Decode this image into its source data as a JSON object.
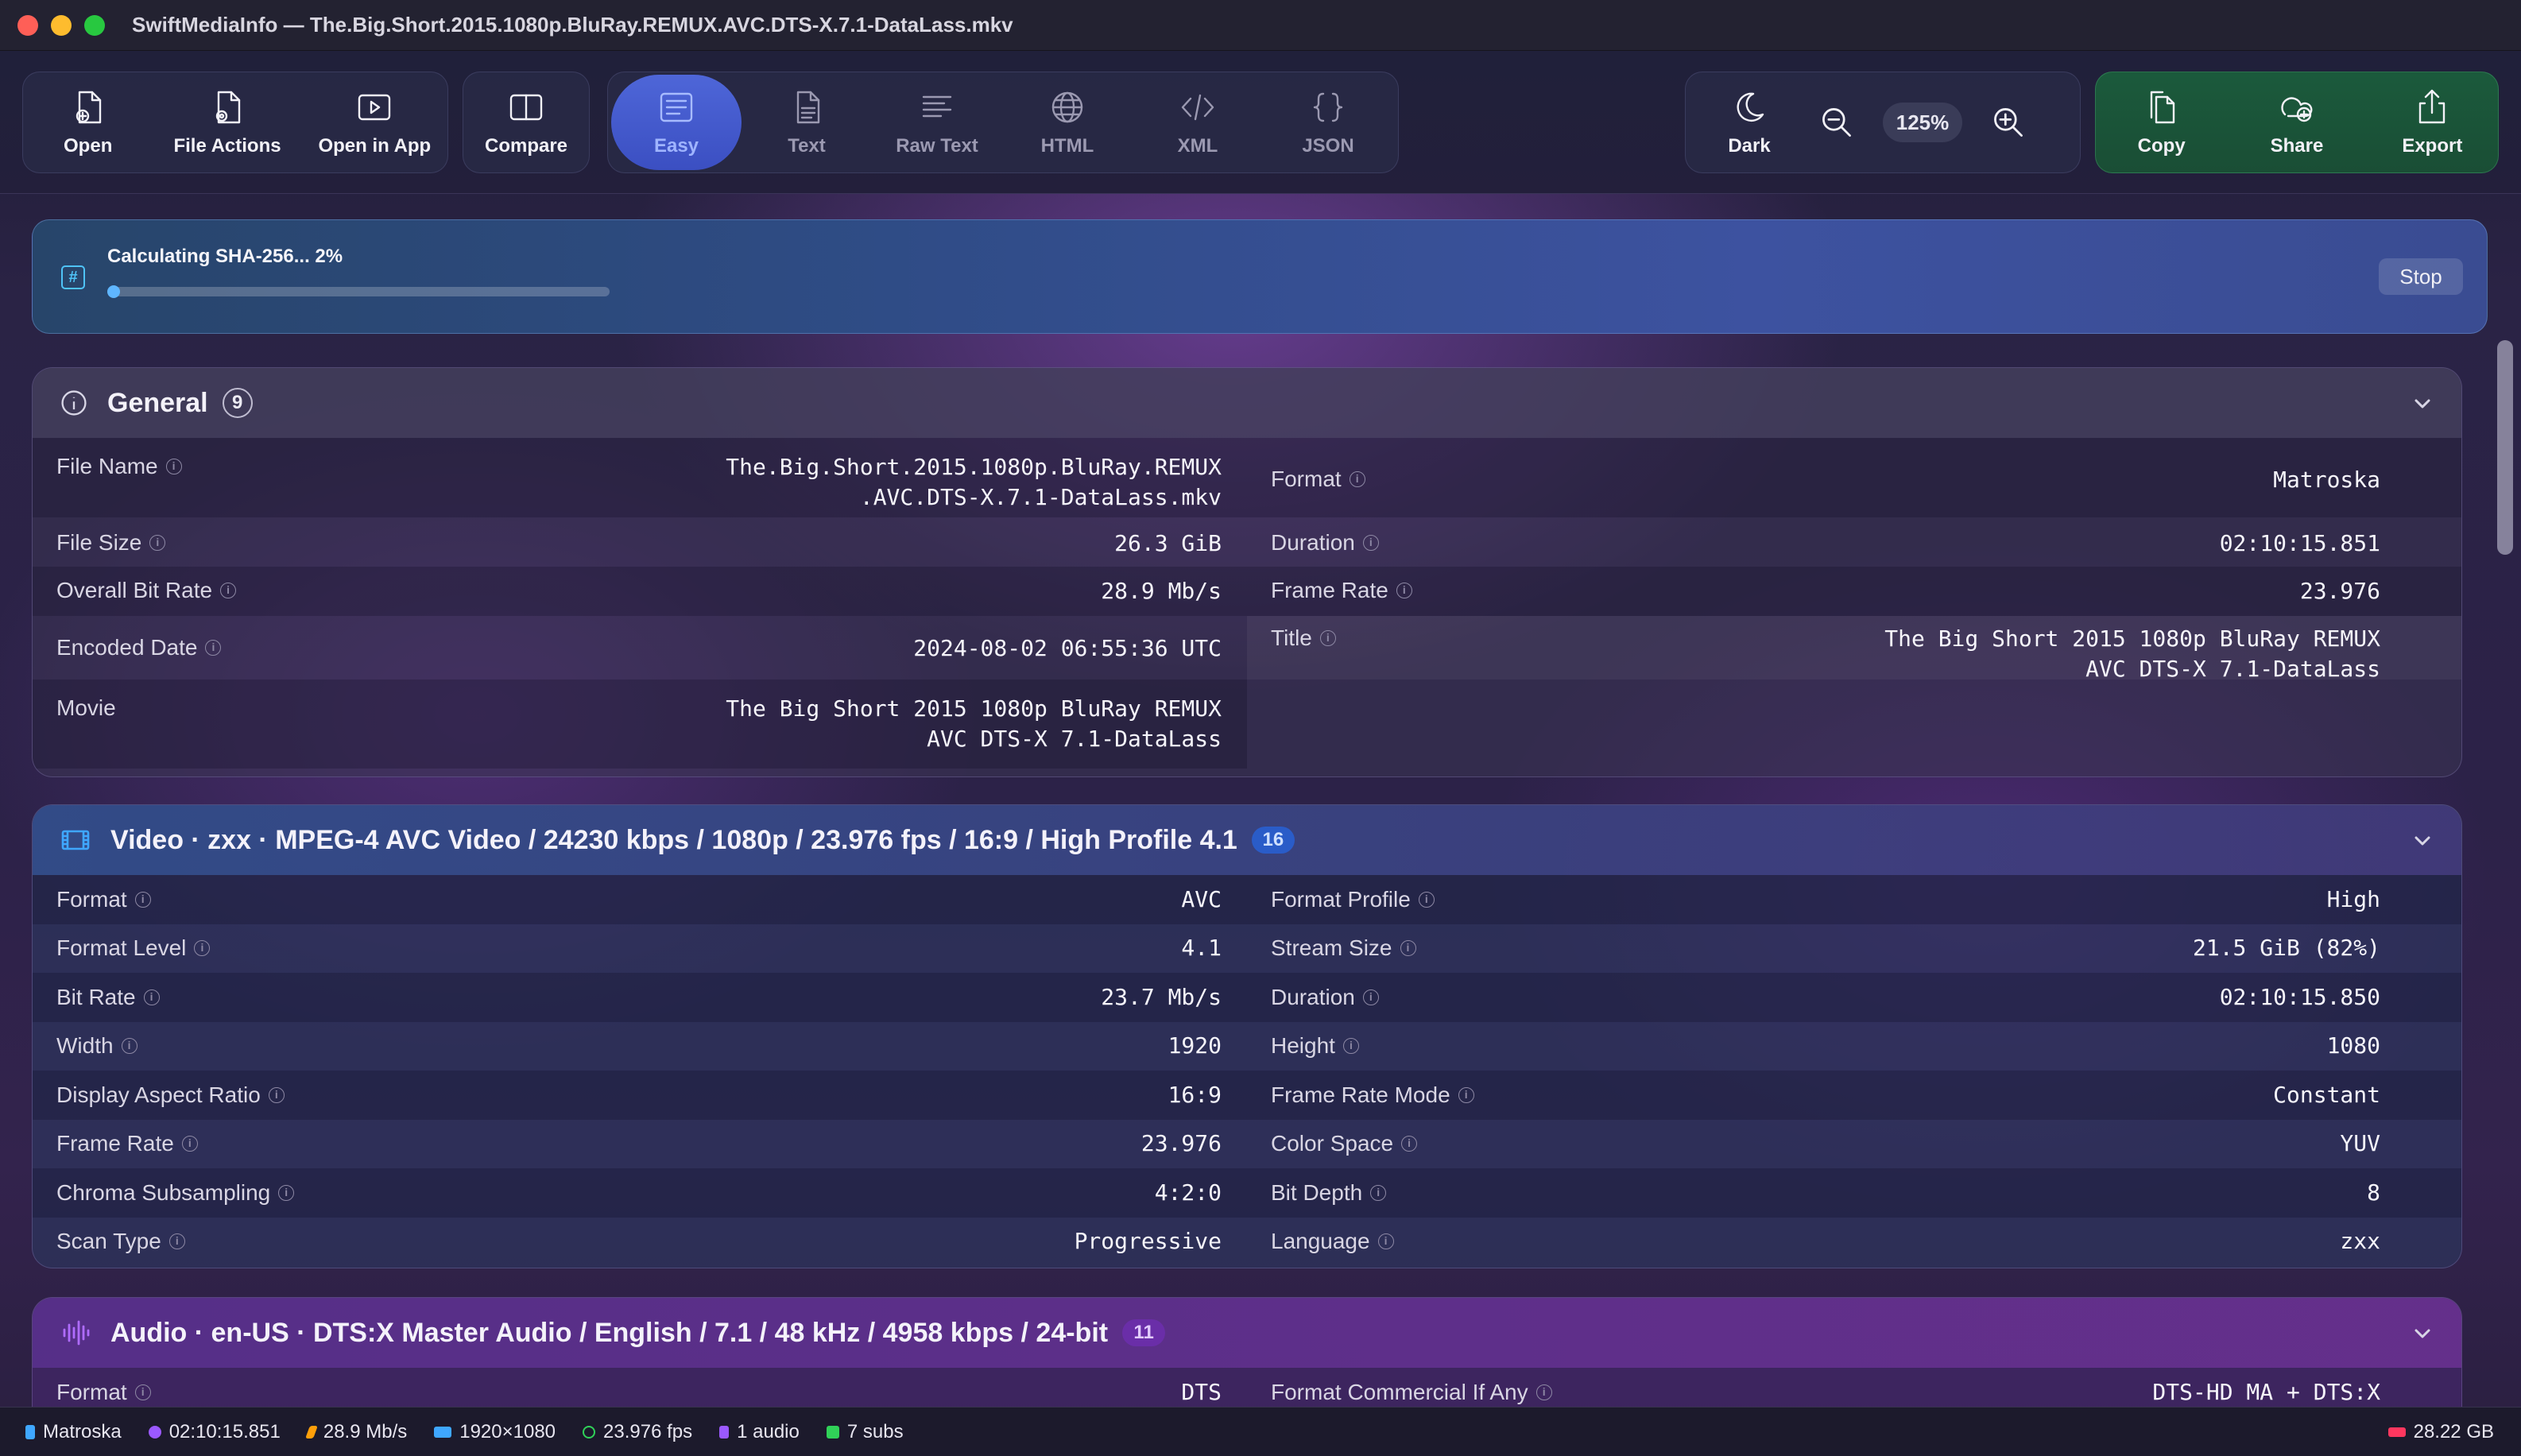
{
  "window": {
    "title": "SwiftMediaInfo — The.Big.Short.2015.1080p.BluRay.REMUX.AVC.DTS-X.7.1-DataLass.mkv"
  },
  "toolbar": {
    "open": "Open",
    "file_actions": "File Actions",
    "open_in_app": "Open in App",
    "compare": "Compare",
    "views": [
      "Easy",
      "Text",
      "Raw Text",
      "HTML",
      "XML",
      "JSON"
    ],
    "active_view": "Easy",
    "dark": "Dark",
    "zoom": "125%",
    "copy": "Copy",
    "share": "Share",
    "export": "Export"
  },
  "progress": {
    "text": "Calculating SHA-256... 2%",
    "percent": 2,
    "stop": "Stop"
  },
  "general": {
    "title": "General",
    "count": "9",
    "left": [
      {
        "label": "File Name",
        "value": "The.Big.Short.2015.1080p.BluRay.REMUX\n.AVC.DTS-X.7.1-DataLass.mkv",
        "info": true
      },
      {
        "label": "File Size",
        "value": "26.3 GiB",
        "info": true
      },
      {
        "label": "Overall Bit Rate",
        "value": "28.9 Mb/s",
        "info": true
      },
      {
        "label": "Encoded  Date",
        "value": "2024-08-02 06:55:36 UTC",
        "info": true
      },
      {
        "label": "Movie",
        "value": "The Big Short 2015 1080p BluRay REMUX\nAVC DTS-X 7.1-DataLass",
        "info": false
      }
    ],
    "right": [
      {
        "label": "Format",
        "value": "Matroska",
        "info": true
      },
      {
        "label": "Duration",
        "value": "02:10:15.851",
        "info": true
      },
      {
        "label": "Frame Rate",
        "value": "23.976",
        "info": true
      },
      {
        "label": "Title",
        "value": "The Big Short 2015 1080p BluRay REMUX\nAVC DTS-X 7.1-DataLass",
        "info": true
      }
    ]
  },
  "video": {
    "title": "Video · zxx · MPEG-4 AVC Video / 24230 kbps / 1080p / 23.976 fps / 16:9 / High Profile 4.1",
    "count": "16",
    "left": [
      {
        "label": "Format",
        "value": "AVC"
      },
      {
        "label": "Format  Level",
        "value": "4.1"
      },
      {
        "label": "Bit Rate",
        "value": "23.7 Mb/s"
      },
      {
        "label": "Width",
        "value": "1920"
      },
      {
        "label": "Display Aspect Ratio",
        "value": "16:9"
      },
      {
        "label": "Frame Rate",
        "value": "23.976"
      },
      {
        "label": "Chroma Subsampling",
        "value": "4:2:0"
      },
      {
        "label": "Scan Type",
        "value": "Progressive"
      }
    ],
    "right": [
      {
        "label": "Format  Profile",
        "value": "High"
      },
      {
        "label": "Stream Size",
        "value": "21.5 GiB (82%)"
      },
      {
        "label": "Duration",
        "value": "02:10:15.850"
      },
      {
        "label": "Height",
        "value": "1080"
      },
      {
        "label": "Frame Rate  Mode",
        "value": "Constant"
      },
      {
        "label": "Color Space",
        "value": "YUV"
      },
      {
        "label": "Bit Depth",
        "value": "8"
      },
      {
        "label": "Language",
        "value": "zxx"
      }
    ]
  },
  "audio": {
    "title": "Audio · en-US · DTS:X Master Audio / English / 7.1 / 48 kHz / 4958 kbps / 24-bit",
    "count": "11",
    "left": [
      {
        "label": "Format",
        "value": "DTS"
      }
    ],
    "right": [
      {
        "label": "Format  Commercial  If Any",
        "value": "DTS-HD  MA + DTS:X"
      }
    ]
  },
  "statusbar": {
    "container": "Matroska",
    "duration": "02:10:15.851",
    "bitrate": "28.9 Mb/s",
    "resolution": "1920×1080",
    "fps": "23.976 fps",
    "audio": "1 audio",
    "subs": "7 subs",
    "size": "28.22 GB"
  },
  "colors": {
    "accent": "#4e66d8",
    "video_icon": "#3fa7ff",
    "audio_icon": "#b06cff",
    "video_badge": "#2a5cc8",
    "audio_badge": "#6a2ea8",
    "general_badge": "#5a5570"
  }
}
